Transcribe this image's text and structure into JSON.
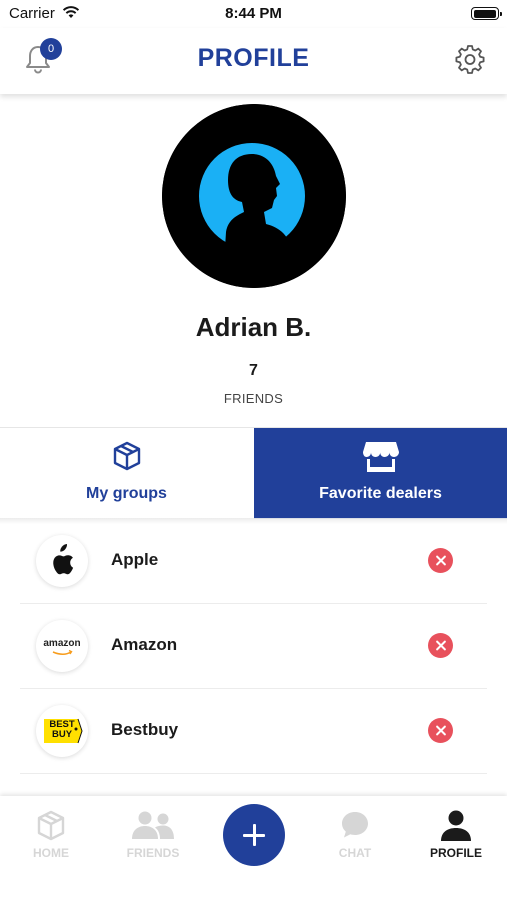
{
  "status_bar": {
    "carrier": "Carrier",
    "time": "8:44 PM"
  },
  "header": {
    "title": "PROFILE",
    "notification_count": "0",
    "accent_color": "#21409a"
  },
  "profile": {
    "name": "Adrian B.",
    "friends_count": "7",
    "friends_label": "FRIENDS"
  },
  "tabs": [
    {
      "label": "My groups",
      "icon": "cube-icon",
      "active": false
    },
    {
      "label": "Favorite dealers",
      "icon": "storefront-icon",
      "active": true
    }
  ],
  "dealers": [
    {
      "name": "Apple",
      "logo": "apple-logo"
    },
    {
      "name": "Amazon",
      "logo": "amazon-logo",
      "logo_text": "amazon"
    },
    {
      "name": "Bestbuy",
      "logo": "bestbuy-logo",
      "logo_text": "BEST BUY"
    }
  ],
  "bottom_nav": [
    {
      "label": "HOME",
      "icon": "cube-icon",
      "active": false
    },
    {
      "label": "FRIENDS",
      "icon": "people-icon",
      "active": false
    },
    {
      "label": "",
      "icon": "plus-icon",
      "active": false
    },
    {
      "label": "CHAT",
      "icon": "chat-bubble-icon",
      "active": false
    },
    {
      "label": "PROFILE",
      "icon": "person-icon",
      "active": true
    }
  ],
  "colors": {
    "primary": "#21409a",
    "remove": "#e8515c",
    "inactive_nav": "#d6d6d6"
  }
}
